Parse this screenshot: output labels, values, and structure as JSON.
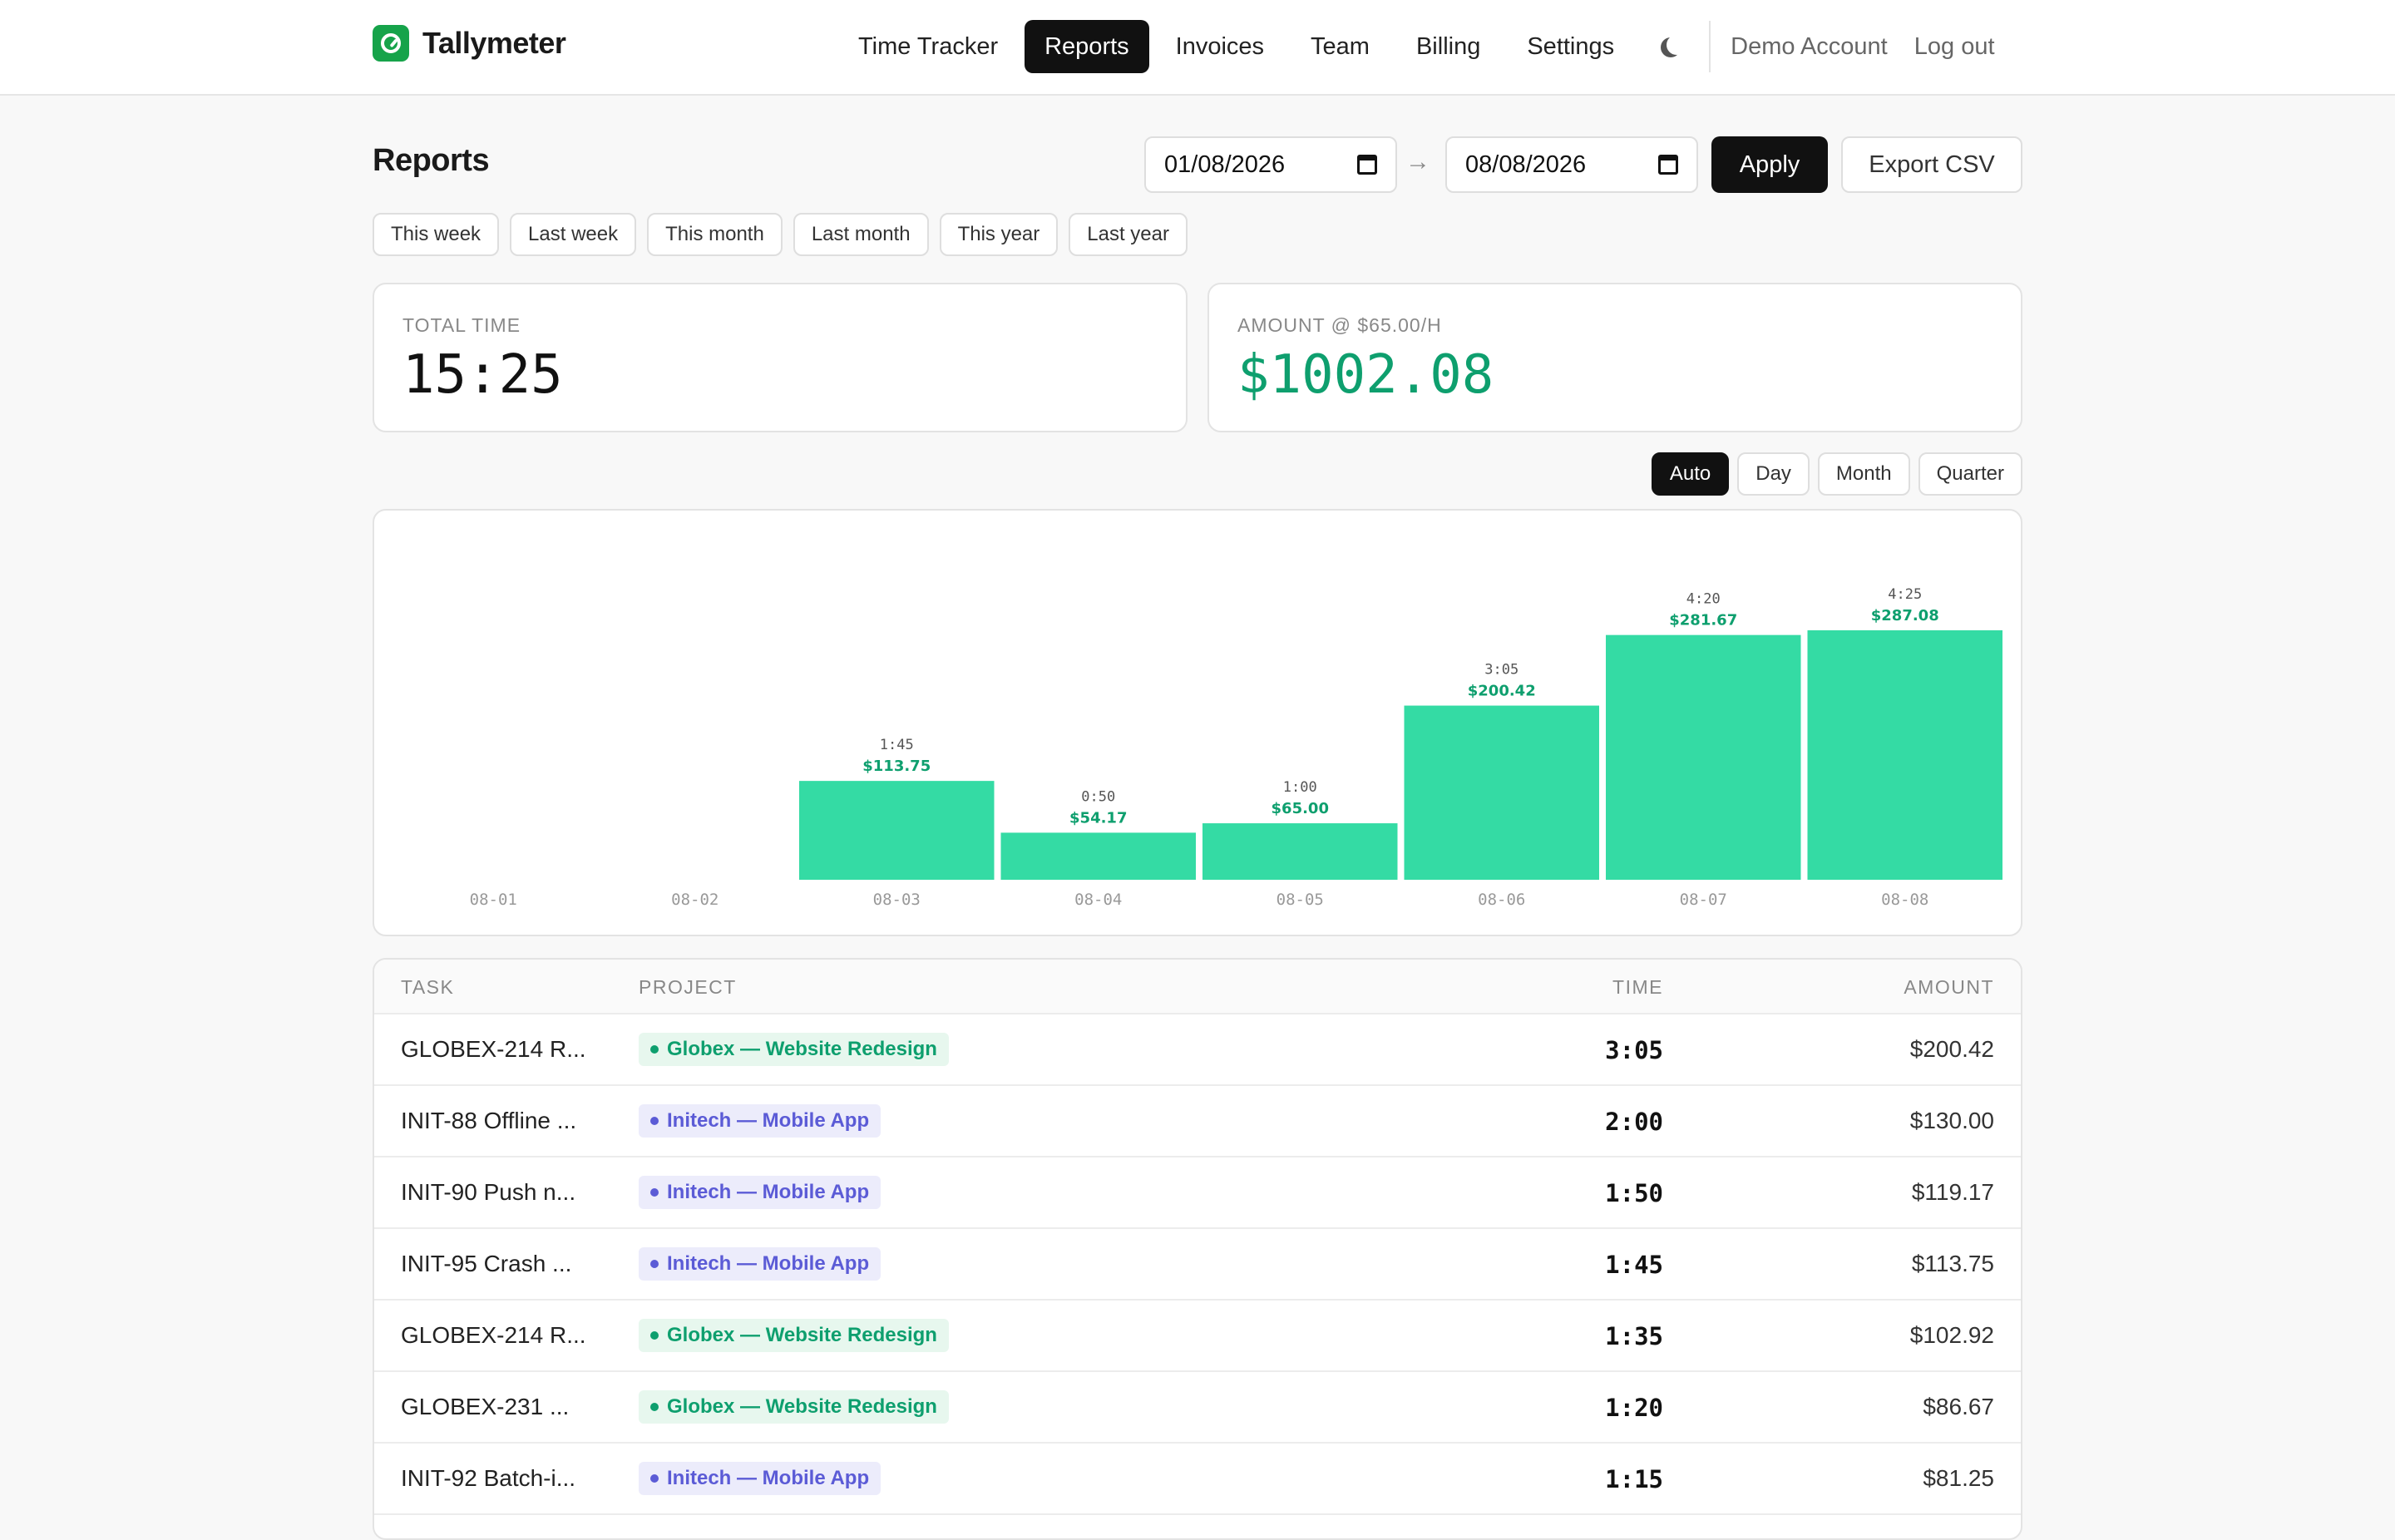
{
  "app": {
    "name": "Tallymeter"
  },
  "nav": {
    "items": [
      "Time Tracker",
      "Reports",
      "Invoices",
      "Team",
      "Billing",
      "Settings"
    ],
    "active": "Reports",
    "account": "Demo Account",
    "logout": "Log out"
  },
  "page": {
    "title": "Reports",
    "date_from": "01/08/2026",
    "date_to": "08/08/2026",
    "apply_label": "Apply",
    "export_label": "Export CSV",
    "presets": [
      "This week",
      "Last week",
      "This month",
      "Last month",
      "This year",
      "Last year"
    ]
  },
  "summary": {
    "total_time_label": "TOTAL TIME",
    "total_time": "15:25",
    "amount_label": "AMOUNT @ $65.00/H",
    "amount": "$1002.08"
  },
  "granularity": {
    "options": [
      "Auto",
      "Day",
      "Month",
      "Quarter"
    ],
    "selected": "Auto"
  },
  "chart_data": {
    "type": "bar",
    "categories": [
      "08-01",
      "08-02",
      "08-03",
      "08-04",
      "08-05",
      "08-06",
      "08-07",
      "08-08"
    ],
    "values": [
      0,
      0,
      113.75,
      54.17,
      65.0,
      200.42,
      281.67,
      287.08
    ],
    "time_labels": [
      "",
      "",
      "1:45",
      "0:50",
      "1:00",
      "3:05",
      "4:20",
      "4:25"
    ],
    "amount_labels": [
      "",
      "",
      "$113.75",
      "$54.17",
      "$65.00",
      "$200.42",
      "$281.67",
      "$287.08"
    ],
    "bar_color": "#34dba4",
    "amount_label_color": "#0e9f6e"
  },
  "table": {
    "headers": {
      "task": "TASK",
      "project": "PROJECT",
      "time": "TIME",
      "amount": "AMOUNT"
    },
    "rows": [
      {
        "task": "GLOBEX-214 R...",
        "project": "Globex — Website Redesign",
        "color": "green",
        "time": "3:05",
        "amount": "$200.42"
      },
      {
        "task": "INIT-88 Offline ...",
        "project": "Initech — Mobile App",
        "color": "purple",
        "time": "2:00",
        "amount": "$130.00"
      },
      {
        "task": "INIT-90 Push n...",
        "project": "Initech — Mobile App",
        "color": "purple",
        "time": "1:50",
        "amount": "$119.17"
      },
      {
        "task": "INIT-95 Crash ...",
        "project": "Initech — Mobile App",
        "color": "purple",
        "time": "1:45",
        "amount": "$113.75"
      },
      {
        "task": "GLOBEX-214 R...",
        "project": "Globex — Website Redesign",
        "color": "green",
        "time": "1:35",
        "amount": "$102.92"
      },
      {
        "task": "GLOBEX-231 ...",
        "project": "Globex — Website Redesign",
        "color": "green",
        "time": "1:20",
        "amount": "$86.67"
      },
      {
        "task": "INIT-92 Batch-i...",
        "project": "Initech — Mobile App",
        "color": "purple",
        "time": "1:15",
        "amount": "$81.25"
      }
    ]
  }
}
